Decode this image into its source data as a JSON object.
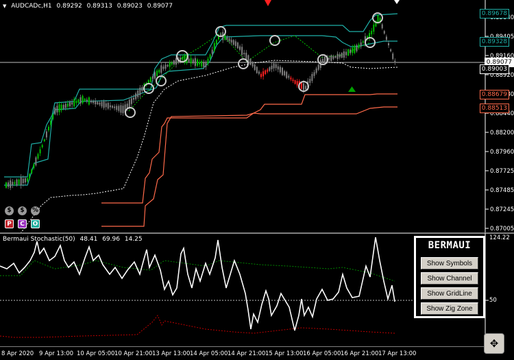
{
  "header": {
    "symbol": "AUDCADc,H1",
    "open": "0.89292",
    "high": "0.89313",
    "low": "0.89023",
    "close": "0.89077"
  },
  "price_axis": [
    "0.89640",
    "0.89405",
    "0.89160",
    "0.88920",
    "0.88680",
    "0.88440",
    "0.88200",
    "0.87960",
    "0.87725",
    "0.87485",
    "0.87245",
    "0.87005"
  ],
  "price_labels": {
    "top_channel": "0.89678",
    "upper_channel": "0.89328",
    "current": "0.89077",
    "mid": "0.89003",
    "lower_channel": "0.88679",
    "bottom_channel": "0.88513"
  },
  "indicator": {
    "name": "Bermaui Stochastic(50)",
    "v1": "48.41",
    "v2": "69.96",
    "v3": "14.25",
    "axis_top": "124.22",
    "axis_mid": "50"
  },
  "panel": {
    "title": "BERMAUI",
    "buttons": [
      "Show Symbols",
      "Show Channel",
      "Show GridLine",
      "Show Zig Zone"
    ]
  },
  "tools": {
    "row1": [
      "$",
      "$",
      "%"
    ],
    "row2": [
      "P",
      "C",
      "O"
    ]
  },
  "time_axis": [
    "8 Apr 2020",
    "9 Apr 13:00",
    "10 Apr 05:00",
    "10 Apr 21:00",
    "13 Apr 13:00",
    "14 Apr 05:00",
    "14 Apr 21:00",
    "15 Apr 13:00",
    "16 Apr 05:00",
    "16 Apr 21:00",
    "17 Apr 13:00"
  ],
  "colors": {
    "bull": "#00c000",
    "bear": "#ff0000",
    "neutral": "#808080",
    "channel": "#1fb0a8",
    "lower": "#ff6a4a",
    "signal": "#00ff00"
  },
  "zoom_icon": "move-icon"
}
